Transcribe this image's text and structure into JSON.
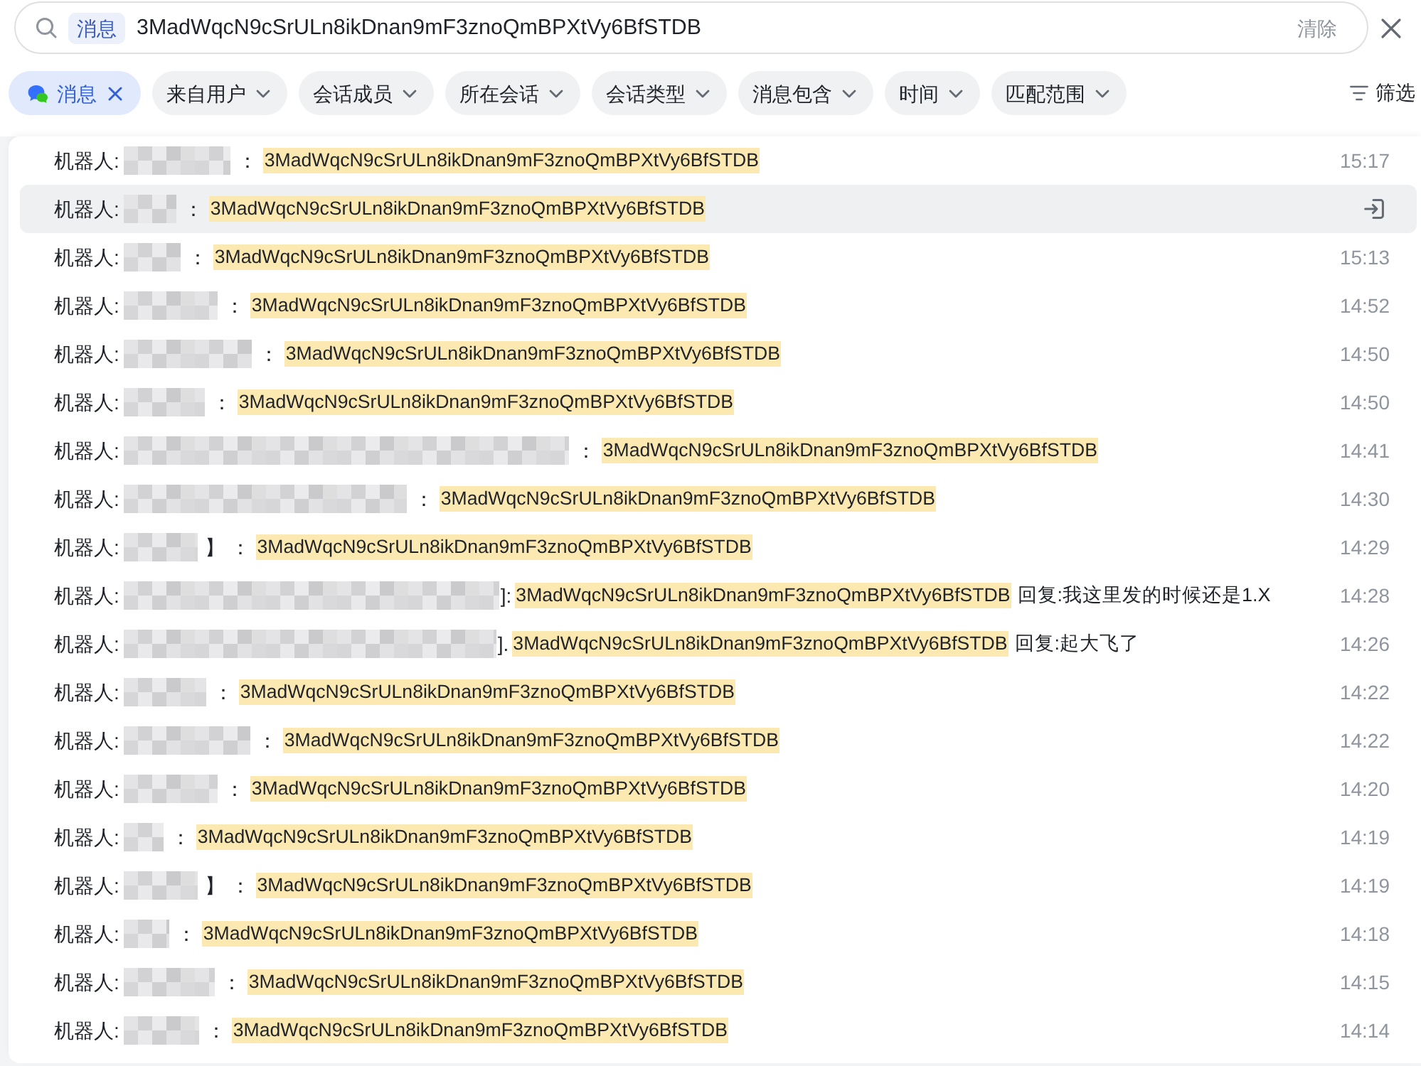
{
  "search": {
    "scope_tag": "消息",
    "value": "3MadWqcN9cSrULn8ikDnan9mF3znoQmBPXtVy6BfSTDB",
    "clear_label": "清除"
  },
  "filters": [
    {
      "label": "消息",
      "kind": "removable",
      "selected": true
    },
    {
      "label": "来自用户",
      "kind": "dropdown",
      "selected": false
    },
    {
      "label": "会话成员",
      "kind": "dropdown",
      "selected": false
    },
    {
      "label": "所在会话",
      "kind": "dropdown",
      "selected": false
    },
    {
      "label": "会话类型",
      "kind": "dropdown",
      "selected": false
    },
    {
      "label": "消息包含",
      "kind": "dropdown",
      "selected": false
    },
    {
      "label": "时间",
      "kind": "dropdown",
      "selected": false
    },
    {
      "label": "匹配范围",
      "kind": "dropdown",
      "selected": false
    }
  ],
  "filter_button": {
    "label": "筛选"
  },
  "results": [
    {
      "sender": "机器人:",
      "separator": "：",
      "match": "3MadWqcN9cSrULn8ikDnan9mF3znoQmBPXtVy6BfSTDB",
      "time": "15:17",
      "hovered": false
    },
    {
      "sender": "机器人:",
      "separator": "：",
      "match": "3MadWqcN9cSrULn8ikDnan9mF3znoQmBPXtVy6BfSTDB",
      "hovered": true
    },
    {
      "sender": "机器人:",
      "separator": "：",
      "match": "3MadWqcN9cSrULn8ikDnan9mF3znoQmBPXtVy6BfSTDB",
      "time": "15:13",
      "hovered": false
    },
    {
      "sender": "机器人:",
      "separator": "：",
      "match": "3MadWqcN9cSrULn8ikDnan9mF3znoQmBPXtVy6BfSTDB",
      "time": "14:52",
      "hovered": false
    },
    {
      "sender": "机器人:",
      "separator": "：",
      "match": "3MadWqcN9cSrULn8ikDnan9mF3znoQmBPXtVy6BfSTDB",
      "time": "14:50",
      "hovered": false
    },
    {
      "sender": "机器人:",
      "separator": "：",
      "match": "3MadWqcN9cSrULn8ikDnan9mF3znoQmBPXtVy6BfSTDB",
      "time": "14:50",
      "hovered": false
    },
    {
      "sender": "机器人:",
      "separator": "：",
      "match": "3MadWqcN9cSrULn8ikDnan9mF3znoQmBPXtVy6BfSTDB",
      "time": "14:41",
      "hovered": false
    },
    {
      "sender": "机器人:",
      "separator": "：",
      "match": "3MadWqcN9cSrULn8ikDnan9mF3znoQmBPXtVy6BfSTDB",
      "time": "14:30",
      "hovered": false
    },
    {
      "sender": "机器人:",
      "separator": "】 ：",
      "match": "3MadWqcN9cSrULn8ikDnan9mF3znoQmBPXtVy6BfSTDB",
      "time": "14:29",
      "hovered": false
    },
    {
      "sender": "机器人:",
      "separator": "]:",
      "match": "3MadWqcN9cSrULn8ikDnan9mF3znoQmBPXtVy6BfSTDB",
      "reply": "回复:我这里发的时候还是1.X",
      "time": "14:28",
      "hovered": false
    },
    {
      "sender": "机器人:",
      "separator": "].",
      "match": "3MadWqcN9cSrULn8ikDnan9mF3znoQmBPXtVy6BfSTDB",
      "reply": "回复:起大飞了",
      "time": "14:26",
      "hovered": false
    },
    {
      "sender": "机器人:",
      "separator": "：",
      "match": "3MadWqcN9cSrULn8ikDnan9mF3znoQmBPXtVy6BfSTDB",
      "time": "14:22",
      "hovered": false
    },
    {
      "sender": "机器人:",
      "separator": "：",
      "match": "3MadWqcN9cSrULn8ikDnan9mF3znoQmBPXtVy6BfSTDB",
      "time": "14:22",
      "hovered": false
    },
    {
      "sender": "机器人:",
      "separator": "：",
      "match": "3MadWqcN9cSrULn8ikDnan9mF3znoQmBPXtVy6BfSTDB",
      "time": "14:20",
      "hovered": false
    },
    {
      "sender": "机器人:",
      "separator": "：",
      "match": "3MadWqcN9cSrULn8ikDnan9mF3znoQmBPXtVy6BfSTDB",
      "time": "14:19",
      "hovered": false
    },
    {
      "sender": "机器人:",
      "separator": "】 ：",
      "match": "3MadWqcN9cSrULn8ikDnan9mF3znoQmBPXtVy6BfSTDB",
      "time": "14:19",
      "hovered": false
    },
    {
      "sender": "机器人:",
      "separator": "：",
      "match": "3MadWqcN9cSrULn8ikDnan9mF3znoQmBPXtVy6BfSTDB",
      "time": "14:18",
      "hovered": false
    },
    {
      "sender": "机器人:",
      "separator": "：",
      "match": "3MadWqcN9cSrULn8ikDnan9mF3znoQmBPXtVy6BfSTDB",
      "time": "14:15",
      "hovered": false
    },
    {
      "sender": "机器人:",
      "separator": "：",
      "match": "3MadWqcN9cSrULn8ikDnan9mF3znoQmBPXtVy6BfSTDB",
      "time": "14:14",
      "hovered": false
    }
  ]
}
